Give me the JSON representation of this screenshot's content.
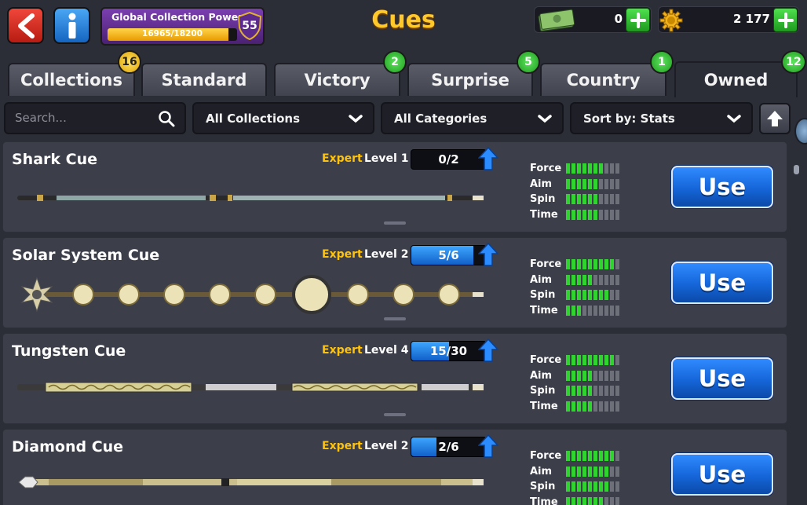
{
  "header": {
    "title": "Cues",
    "power": {
      "label": "Global Collection Power",
      "progress_text": "16965/18200",
      "current": 16965,
      "max": 18200,
      "level": "55"
    },
    "cash": {
      "amount": "0",
      "icon": "banknotes-icon"
    },
    "coins": {
      "amount": "2 177",
      "icon": "gear-coin-icon"
    }
  },
  "tabs": [
    {
      "label": "Collections",
      "badge": "16",
      "badge_color": "#f0b400"
    },
    {
      "label": "Standard",
      "badge": ""
    },
    {
      "label": "Victory",
      "badge": "2",
      "badge_color": "#2ab52a"
    },
    {
      "label": "Surprise",
      "badge": "5",
      "badge_color": "#2ab52a"
    },
    {
      "label": "Country",
      "badge": "1",
      "badge_color": "#2ab52a"
    },
    {
      "label": "Owned",
      "badge": "12",
      "badge_color": "#2ab52a",
      "active": true
    }
  ],
  "filters": {
    "search_placeholder": "Search...",
    "collections": "All Collections",
    "categories": "All Categories",
    "sort": "Sort by: Stats"
  },
  "stat_labels": [
    "Force",
    "Aim",
    "Spin",
    "Time"
  ],
  "cues": [
    {
      "name": "Shark Cue",
      "tier": "Expert",
      "level": "Level 1",
      "progress": "0/2",
      "progress_frac": 0,
      "stats": [
        7,
        6,
        6,
        6
      ],
      "use_label": "Use"
    },
    {
      "name": "Solar System Cue",
      "tier": "Expert",
      "level": "Level 2",
      "progress": "5/6",
      "progress_frac": 0.833,
      "stats": [
        9,
        5,
        8,
        3
      ],
      "use_label": "Use"
    },
    {
      "name": "Tungsten Cue",
      "tier": "Expert",
      "level": "Level 4",
      "progress": "15/30",
      "progress_frac": 0.5,
      "stats": [
        9,
        5,
        5,
        5
      ],
      "use_label": "Use"
    },
    {
      "name": "Diamond Cue",
      "tier": "Expert",
      "level": "Level 2",
      "progress": "2/6",
      "progress_frac": 0.333,
      "stats": [
        9,
        8,
        8,
        7
      ],
      "use_label": "Use"
    }
  ],
  "colors": {
    "accent_gold": "#ffc92b",
    "stat_green": "#2fd42f",
    "use_blue": "#1565d8",
    "progress_blue": "#1e88e5"
  }
}
